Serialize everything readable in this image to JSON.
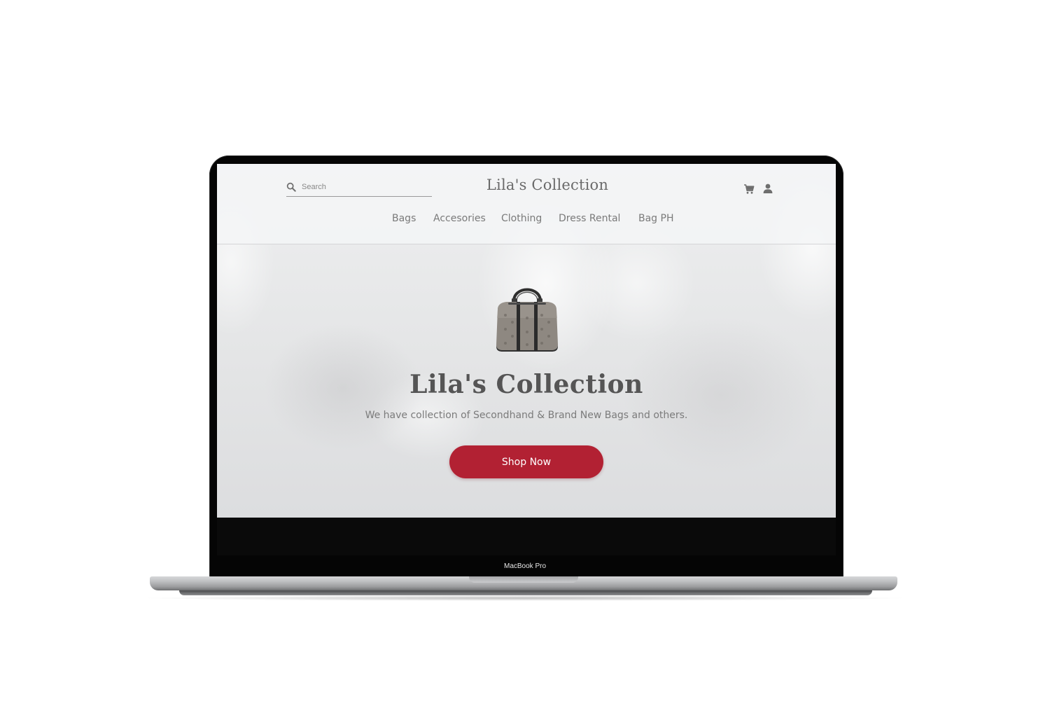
{
  "header": {
    "search_placeholder": "Search",
    "brand": "Lila's Collection",
    "cart_icon": "cart-icon",
    "user_icon": "user-icon"
  },
  "nav": {
    "items": [
      {
        "label": "Bags"
      },
      {
        "label": "Accesories"
      },
      {
        "label": "Clothing"
      },
      {
        "label": "Dress Rental"
      },
      {
        "label": "Bag PH"
      }
    ]
  },
  "hero": {
    "image": "handbag-image",
    "title": "Lila's Collection",
    "subtitle": "We have collection of Secondhand & Brand New Bags and others.",
    "cta_label": "Shop Now"
  },
  "device": {
    "model_label": "MacBook Pro"
  },
  "colors": {
    "accent": "#b22133",
    "text_muted": "#7a7a7a",
    "title": "#555555"
  }
}
